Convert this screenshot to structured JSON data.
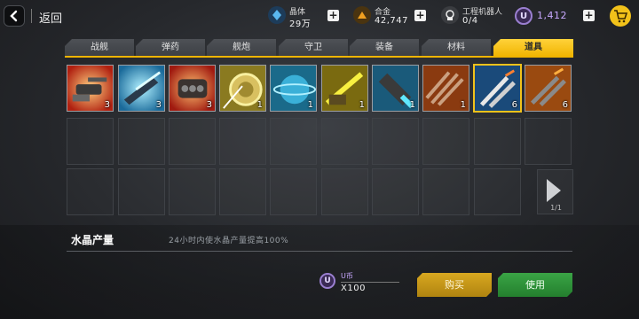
{
  "header": {
    "back_label": "返回",
    "resources": [
      {
        "name": "晶体",
        "value": "29万",
        "icon": "crystal-icon",
        "color": "#3aa0e8"
      },
      {
        "name": "合金",
        "value": "42,747",
        "icon": "alloy-icon",
        "color": "#f0a020"
      },
      {
        "name": "工程机器人",
        "value": "0/4",
        "icon": "robot-icon",
        "color": "#e8e8e8"
      }
    ],
    "ucoin": {
      "symbol": "U",
      "value": "1,412",
      "color": "#c8a8ff"
    },
    "plus_symbol": "+",
    "cart_icon": "shopping-cart-icon"
  },
  "tabs": [
    {
      "label": "战舰",
      "active": false
    },
    {
      "label": "弹药",
      "active": false
    },
    {
      "label": "舰炮",
      "active": false
    },
    {
      "label": "守卫",
      "active": false
    },
    {
      "label": "装备",
      "active": false
    },
    {
      "label": "材料",
      "active": false
    },
    {
      "label": "道具",
      "active": true
    }
  ],
  "items": [
    {
      "count": "3",
      "icon": "turret-icon",
      "bg": "#c83020"
    },
    {
      "count": "3",
      "icon": "plasma-cannon-icon",
      "bg": "#2a9ac8"
    },
    {
      "count": "3",
      "icon": "ammo-pack-icon",
      "bg": "#c83020"
    },
    {
      "count": "1",
      "icon": "shield-disc-icon",
      "bg": "#b8a020"
    },
    {
      "count": "1",
      "icon": "planet-orb-icon",
      "bg": "#2a9ac8"
    },
    {
      "count": "1",
      "icon": "rail-gun-icon",
      "bg": "#b8a020"
    },
    {
      "count": "1",
      "icon": "energy-canister-icon",
      "bg": "#2a9ac8"
    },
    {
      "count": "1",
      "icon": "missile-salvo-icon",
      "bg": "#c85020"
    },
    {
      "count": "6",
      "icon": "boost-rockets-icon",
      "bg": "#2a7ac8",
      "selected": true
    },
    {
      "count": "6",
      "icon": "rocket-bundle-icon",
      "bg": "#c86020"
    }
  ],
  "pager": {
    "indicator": "1/1"
  },
  "selected_item": {
    "name": "水晶产量",
    "description": "24小时内使水晶产量提高100%"
  },
  "cost": {
    "currency_symbol": "U",
    "currency_name": "U币",
    "amount": "X100"
  },
  "actions": {
    "buy_label": "购买",
    "use_label": "使用"
  }
}
